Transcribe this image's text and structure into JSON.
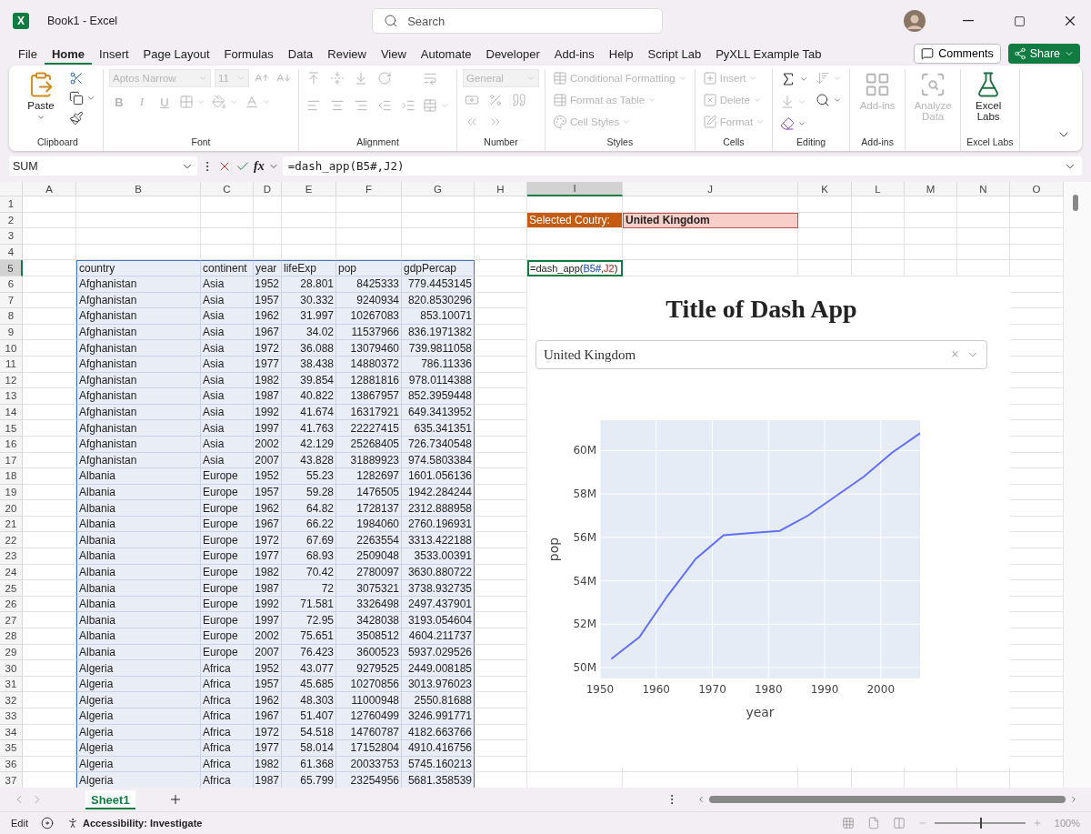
{
  "window": {
    "logo_letter": "X",
    "title": "Book1 - Excel",
    "search_placeholder": "Search"
  },
  "menu": {
    "tabs": [
      {
        "label": "File",
        "selected": false
      },
      {
        "label": "Home",
        "selected": true
      },
      {
        "label": "Insert",
        "selected": false
      },
      {
        "label": "Page Layout",
        "selected": false
      },
      {
        "label": "Formulas",
        "selected": false
      },
      {
        "label": "Data",
        "selected": false
      },
      {
        "label": "Review",
        "selected": false
      },
      {
        "label": "View",
        "selected": false
      },
      {
        "label": "Automate",
        "selected": false
      },
      {
        "label": "Developer",
        "selected": false
      },
      {
        "label": "Add-ins",
        "selected": false
      },
      {
        "label": "Help",
        "selected": false
      },
      {
        "label": "Script Lab",
        "selected": false
      },
      {
        "label": "PyXLL Example Tab",
        "selected": false
      }
    ],
    "comments_button": "Comments",
    "share_button": "Share"
  },
  "ribbon": {
    "groups": [
      {
        "kind": "clipboard",
        "label": "Clipboard",
        "items": [
          {
            "label": "Paste",
            "disabled": false
          },
          {
            "disabled": false
          },
          {
            "disabled": false
          },
          {
            "disabled": false
          }
        ]
      },
      {
        "kind": "font",
        "label": "Font",
        "font_name": "Aptos Narrow",
        "font_size": "11",
        "style_buttons": [
          "B",
          "I",
          "U"
        ],
        "disabled": true
      },
      {
        "kind": "alignment",
        "label": "Alignment",
        "disabled": true
      },
      {
        "kind": "number",
        "label": "Number",
        "format": "General",
        "disabled": true
      },
      {
        "kind": "list",
        "label": "Styles",
        "items": [
          {
            "label": "Conditional Formatting",
            "disabled": true
          },
          {
            "label": "Format as Table",
            "disabled": true
          },
          {
            "label": "Cell Styles",
            "disabled": true
          }
        ]
      },
      {
        "kind": "list",
        "label": "Cells",
        "items": [
          {
            "label": "Insert",
            "disabled": true
          },
          {
            "label": "Delete",
            "disabled": true
          },
          {
            "label": "Format",
            "disabled": true
          }
        ]
      },
      {
        "kind": "editing",
        "label": "Editing",
        "items": [
          {
            "disabled": false
          },
          {
            "disabled": true
          },
          {
            "disabled": true
          },
          {
            "disabled": false
          },
          {
            "disabled": false
          }
        ]
      },
      {
        "kind": "large",
        "label": "Add-ins",
        "items": [
          {
            "label": "Add-ins",
            "disabled": true
          }
        ]
      },
      {
        "kind": "large",
        "items": [
          {
            "label": "Analyze Data",
            "disabled": true
          }
        ]
      },
      {
        "kind": "large",
        "label": "Excel Labs",
        "items": [
          {
            "label": "Excel Labs",
            "disabled": false
          }
        ]
      }
    ]
  },
  "formula_bar": {
    "name_box": "SUM",
    "function_label": "fx",
    "formula": "=dash_app(B5#,J2)"
  },
  "sheet": {
    "columns": [
      {
        "label": "A",
        "selected": false
      },
      {
        "label": "B",
        "selected": false
      },
      {
        "label": "C",
        "selected": false
      },
      {
        "label": "D",
        "selected": false
      },
      {
        "label": "E",
        "selected": false
      },
      {
        "label": "F",
        "selected": false
      },
      {
        "label": "G",
        "selected": false
      },
      {
        "label": "H",
        "selected": false
      },
      {
        "label": "I",
        "selected": true
      },
      {
        "label": "J",
        "selected": false
      },
      {
        "label": "K",
        "selected": false
      },
      {
        "label": "L",
        "selected": false
      },
      {
        "label": "M",
        "selected": false
      },
      {
        "label": "N",
        "selected": false
      },
      {
        "label": "O",
        "selected": false
      }
    ],
    "rows": [
      {
        "label": "1",
        "selected": false
      },
      {
        "label": "2",
        "selected": false
      },
      {
        "label": "3",
        "selected": false
      },
      {
        "label": "4",
        "selected": false
      },
      {
        "label": "5",
        "selected": true
      },
      {
        "label": "6",
        "selected": false
      },
      {
        "label": "7",
        "selected": false
      },
      {
        "label": "8",
        "selected": false
      },
      {
        "label": "9",
        "selected": false
      },
      {
        "label": "10",
        "selected": false
      },
      {
        "label": "11",
        "selected": false
      },
      {
        "label": "12",
        "selected": false
      },
      {
        "label": "13",
        "selected": false
      },
      {
        "label": "14",
        "selected": false
      },
      {
        "label": "15",
        "selected": false
      },
      {
        "label": "16",
        "selected": false
      },
      {
        "label": "17",
        "selected": false
      },
      {
        "label": "18",
        "selected": false
      },
      {
        "label": "19",
        "selected": false
      },
      {
        "label": "20",
        "selected": false
      },
      {
        "label": "21",
        "selected": false
      },
      {
        "label": "22",
        "selected": false
      },
      {
        "label": "23",
        "selected": false
      },
      {
        "label": "24",
        "selected": false
      },
      {
        "label": "25",
        "selected": false
      },
      {
        "label": "26",
        "selected": false
      },
      {
        "label": "27",
        "selected": false
      },
      {
        "label": "28",
        "selected": false
      },
      {
        "label": "29",
        "selected": false
      },
      {
        "label": "30",
        "selected": false
      },
      {
        "label": "31",
        "selected": false
      },
      {
        "label": "32",
        "selected": false
      },
      {
        "label": "33",
        "selected": false
      },
      {
        "label": "34",
        "selected": false
      },
      {
        "label": "35",
        "selected": false
      },
      {
        "label": "36",
        "selected": false
      },
      {
        "label": "37",
        "selected": false
      }
    ],
    "selected_country": {
      "label": "Selected Coutry:",
      "value": "United Kingdom"
    },
    "formula_cell": [
      {
        "text": "=dash_app("
      },
      {
        "text": "B5#",
        "color": "#4472c4"
      },
      {
        "text": ","
      },
      {
        "text": "J2",
        "color": "#c0504d"
      },
      {
        "text": ")"
      }
    ],
    "data_table": {
      "columns": [
        "country",
        "continent",
        "year",
        "lifeExp",
        "pop",
        "gdpPercap"
      ],
      "rows": [
        [
          "Afghanistan",
          "Asia",
          "1952",
          "28.801",
          "8425333",
          "779.4453145"
        ],
        [
          "Afghanistan",
          "Asia",
          "1957",
          "30.332",
          "9240934",
          "820.8530296"
        ],
        [
          "Afghanistan",
          "Asia",
          "1962",
          "31.997",
          "10267083",
          "853.10071"
        ],
        [
          "Afghanistan",
          "Asia",
          "1967",
          "34.02",
          "11537966",
          "836.1971382"
        ],
        [
          "Afghanistan",
          "Asia",
          "1972",
          "36.088",
          "13079460",
          "739.9811058"
        ],
        [
          "Afghanistan",
          "Asia",
          "1977",
          "38.438",
          "14880372",
          "786.11336"
        ],
        [
          "Afghanistan",
          "Asia",
          "1982",
          "39.854",
          "12881816",
          "978.0114388"
        ],
        [
          "Afghanistan",
          "Asia",
          "1987",
          "40.822",
          "13867957",
          "852.3959448"
        ],
        [
          "Afghanistan",
          "Asia",
          "1992",
          "41.674",
          "16317921",
          "649.3413952"
        ],
        [
          "Afghanistan",
          "Asia",
          "1997",
          "41.763",
          "22227415",
          "635.341351"
        ],
        [
          "Afghanistan",
          "Asia",
          "2002",
          "42.129",
          "25268405",
          "726.7340548"
        ],
        [
          "Afghanistan",
          "Asia",
          "2007",
          "43.828",
          "31889923",
          "974.5803384"
        ],
        [
          "Albania",
          "Europe",
          "1952",
          "55.23",
          "1282697",
          "1601.056136"
        ],
        [
          "Albania",
          "Europe",
          "1957",
          "59.28",
          "1476505",
          "1942.284244"
        ],
        [
          "Albania",
          "Europe",
          "1962",
          "64.82",
          "1728137",
          "2312.888958"
        ],
        [
          "Albania",
          "Europe",
          "1967",
          "66.22",
          "1984060",
          "2760.196931"
        ],
        [
          "Albania",
          "Europe",
          "1972",
          "67.69",
          "2263554",
          "3313.422188"
        ],
        [
          "Albania",
          "Europe",
          "1977",
          "68.93",
          "2509048",
          "3533.00391"
        ],
        [
          "Albania",
          "Europe",
          "1982",
          "70.42",
          "2780097",
          "3630.880722"
        ],
        [
          "Albania",
          "Europe",
          "1987",
          "72",
          "3075321",
          "3738.932735"
        ],
        [
          "Albania",
          "Europe",
          "1992",
          "71.581",
          "3326498",
          "2497.437901"
        ],
        [
          "Albania",
          "Europe",
          "1997",
          "72.95",
          "3428038",
          "3193.054604"
        ],
        [
          "Albania",
          "Europe",
          "2002",
          "75.651",
          "3508512",
          "4604.211737"
        ],
        [
          "Albania",
          "Europe",
          "2007",
          "76.423",
          "3600523",
          "5937.029526"
        ],
        [
          "Algeria",
          "Africa",
          "1952",
          "43.077",
          "9279525",
          "2449.008185"
        ],
        [
          "Algeria",
          "Africa",
          "1957",
          "45.685",
          "10270856",
          "3013.976023"
        ],
        [
          "Algeria",
          "Africa",
          "1962",
          "48.303",
          "11000948",
          "2550.81688"
        ],
        [
          "Algeria",
          "Africa",
          "1967",
          "51.407",
          "12760499",
          "3246.991771"
        ],
        [
          "Algeria",
          "Africa",
          "1972",
          "54.518",
          "14760787",
          "4182.663766"
        ],
        [
          "Algeria",
          "Africa",
          "1977",
          "58.014",
          "17152804",
          "4910.416756"
        ],
        [
          "Algeria",
          "Africa",
          "1982",
          "61.368",
          "20033753",
          "5745.160213"
        ],
        [
          "Algeria",
          "Africa",
          "1987",
          "65.799",
          "23254956",
          "5681.358539"
        ]
      ]
    }
  },
  "dash_app": {
    "title": "Title of Dash App",
    "dropdown_value": "United Kingdom",
    "clear_symbol": "×",
    "chart_data": {
      "type": "line",
      "grid": true,
      "xlabel": "year",
      "ylabel": "pop",
      "x": [
        1952,
        1957,
        1962,
        1967,
        1972,
        1977,
        1982,
        1987,
        1992,
        1997,
        2002,
        2007
      ],
      "series": [
        {
          "color": "#636efa",
          "values": [
            50400000,
            51400000,
            53300000,
            55000000,
            56100000,
            56200000,
            56300000,
            57000000,
            57900000,
            58800000,
            59900000,
            60800000
          ]
        }
      ],
      "xlim": [
        1950,
        2007
      ],
      "ylim": [
        49500000,
        61400000
      ],
      "xticks": [
        {
          "value": 1950,
          "label": "1950"
        },
        {
          "value": 1960,
          "label": "1960"
        },
        {
          "value": 1970,
          "label": "1970"
        },
        {
          "value": 1980,
          "label": "1980"
        },
        {
          "value": 1990,
          "label": "1990"
        },
        {
          "value": 2000,
          "label": "2000"
        }
      ],
      "yticks": [
        {
          "value": 50000000,
          "label": "50M"
        },
        {
          "value": 52000000,
          "label": "52M"
        },
        {
          "value": 54000000,
          "label": "54M"
        },
        {
          "value": 56000000,
          "label": "56M"
        },
        {
          "value": 58000000,
          "label": "58M"
        },
        {
          "value": 60000000,
          "label": "60M"
        }
      ]
    }
  },
  "sheet_tabs": [
    {
      "label": "Sheet1",
      "selected": true
    }
  ],
  "status_bar": {
    "mode": "Edit",
    "accessibility": "Accessibility: Investigate",
    "zoom": {
      "level": 0.5,
      "reading": "100%"
    }
  }
}
